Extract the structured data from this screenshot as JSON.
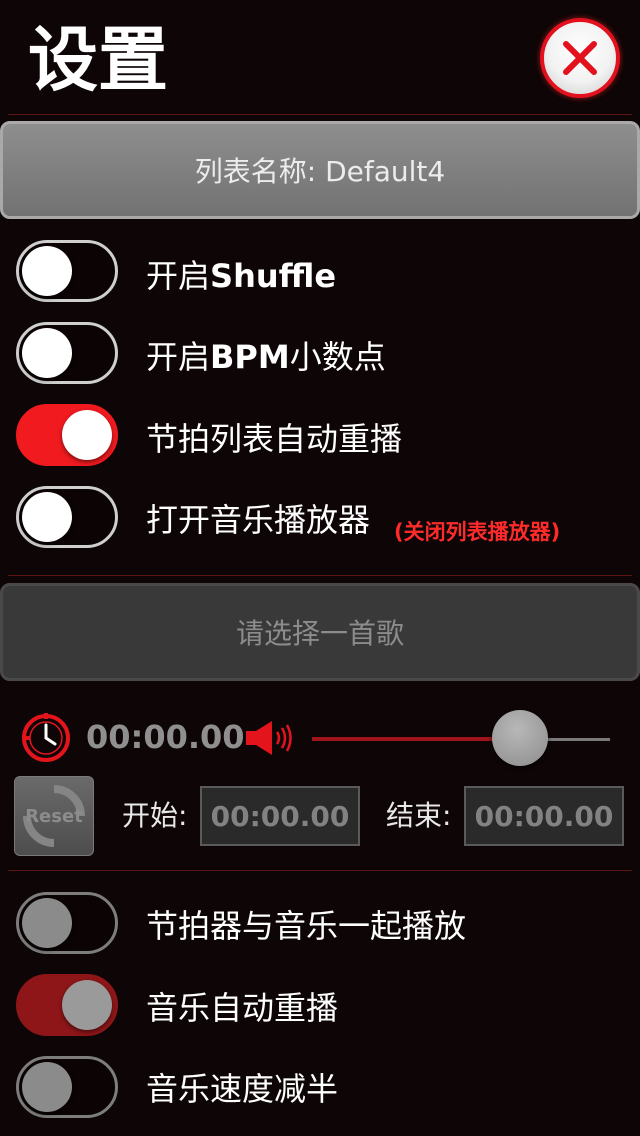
{
  "header": {
    "title": "设置",
    "close_icon": "close-x-icon"
  },
  "list_name_button": {
    "label": "列表名称: Default4"
  },
  "toggles_top": [
    {
      "prefix": "开启",
      "bold": "Shuffle",
      "suffix": "",
      "state": "off"
    },
    {
      "prefix": "开启",
      "bold": "BPM",
      "suffix": "小数点",
      "state": "off"
    },
    {
      "prefix": "节拍列表自动重播",
      "bold": "",
      "suffix": "",
      "state": "on"
    },
    {
      "prefix": "打开音乐播放器",
      "bold": "",
      "suffix": "",
      "state": "off",
      "note": "(关闭列表播放器)"
    }
  ],
  "song_button": {
    "label": "请选择一首歌"
  },
  "player": {
    "clock_icon": "clock-icon",
    "time": "00:00.00",
    "volume_icon": "speaker-icon",
    "volume_level": 0.68,
    "reset_label": "Reset",
    "start_label": "开始:",
    "start_value": "00:00.00",
    "end_label": "结束:",
    "end_value": "00:00.00"
  },
  "toggles_bottom": [
    {
      "label": "节拍器与音乐一起播放",
      "state": "off"
    },
    {
      "label": "音乐自动重播",
      "state": "on"
    },
    {
      "label": "音乐速度减半",
      "state": "off"
    }
  ],
  "colors": {
    "accent": "#f01a1f",
    "background": "#0e0506",
    "dim_accent": "#8e1618"
  }
}
